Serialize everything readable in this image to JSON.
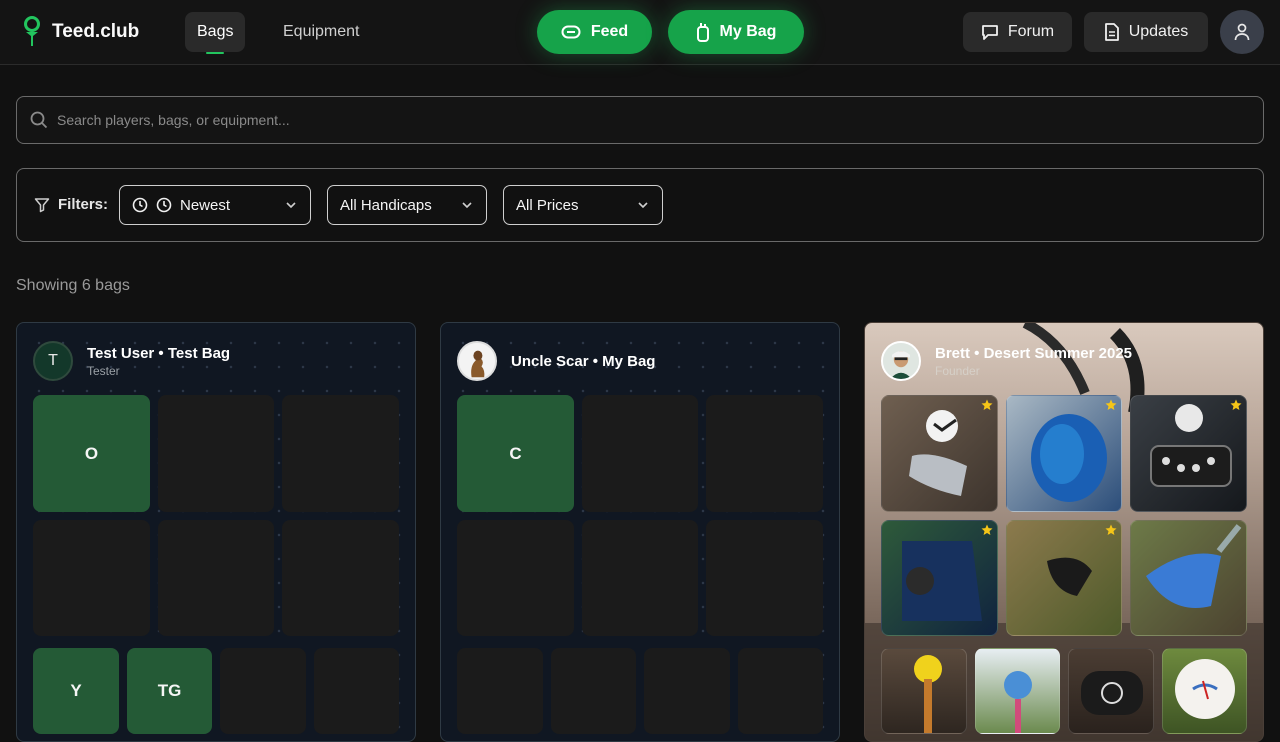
{
  "nav": {
    "brand": "Teed.club",
    "tabs": {
      "bags": "Bags",
      "equipment": "Equipment"
    },
    "feed": "Feed",
    "my_bag": "My Bag",
    "forum": "Forum",
    "updates": "Updates"
  },
  "search": {
    "placeholder": "Search players, bags, or equipment..."
  },
  "filters": {
    "label": "Filters:",
    "sort": "Newest",
    "handicap": "All Handicaps",
    "price": "All Prices"
  },
  "results": {
    "showing": "Showing 6 bags"
  },
  "bags": [
    {
      "avatar_initial": "T",
      "title": "Test User • Test Bag",
      "subtitle": "Tester",
      "tiles": [
        "O",
        "Y",
        "TG"
      ]
    },
    {
      "title": "Uncle Scar • My Bag",
      "tiles": [
        "C"
      ]
    },
    {
      "title": "Brett • Desert Summer 2025",
      "subtitle": "Founder"
    }
  ],
  "colors": {
    "accent": "#16a34a",
    "tile_green": "#245a36",
    "background": "#111111"
  }
}
